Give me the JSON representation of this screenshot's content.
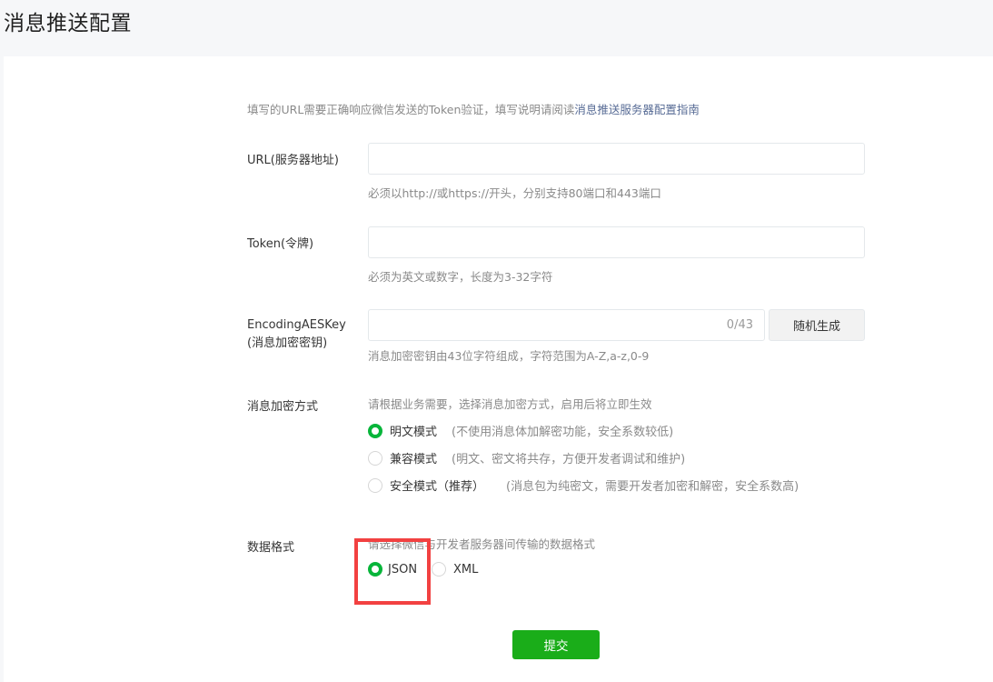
{
  "page_title": "消息推送配置",
  "intro": {
    "text": "填写的URL需要正确响应微信发送的Token验证，填写说明请阅读",
    "link": "消息推送服务器配置指南"
  },
  "url_field": {
    "label": "URL(服务器地址)",
    "value": "",
    "tip": "必须以http://或https://开头，分别支持80端口和443端口"
  },
  "token_field": {
    "label": "Token(令牌)",
    "value": "",
    "tip": "必须为英文或数字，长度为3-32字符"
  },
  "aes_field": {
    "label_line1": "EncodingAESKey",
    "label_line2": "(消息加密密钥)",
    "value": "",
    "counter": "0/43",
    "random_button": "随机生成",
    "tip": "消息加密密钥由43位字符组成，字符范围为A-Z,a-z,0-9"
  },
  "encrypt_mode": {
    "label": "消息加密方式",
    "tip": "请根据业务需要，选择消息加密方式，启用后将立即生效",
    "options": [
      {
        "name": "明文模式",
        "desc": "(不使用消息体加解密功能，安全系数较低)",
        "checked": true
      },
      {
        "name": "兼容模式",
        "desc": "(明文、密文将共存，方便开发者调试和维护)",
        "checked": false
      },
      {
        "name": "安全模式（推荐）",
        "desc": "(消息包为纯密文，需要开发者加密和解密，安全系数高)",
        "checked": false
      }
    ]
  },
  "data_format": {
    "label": "数据格式",
    "tip": "请选择微信与开发者服务器间传输的数据格式",
    "options": [
      {
        "name": "JSON",
        "checked": true
      },
      {
        "name": "XML",
        "checked": false
      }
    ]
  },
  "submit_button": "提交",
  "colors": {
    "accent": "#07b53a",
    "primary_button": "#1aad19",
    "link": "#576b95",
    "highlight": "#f24141"
  }
}
